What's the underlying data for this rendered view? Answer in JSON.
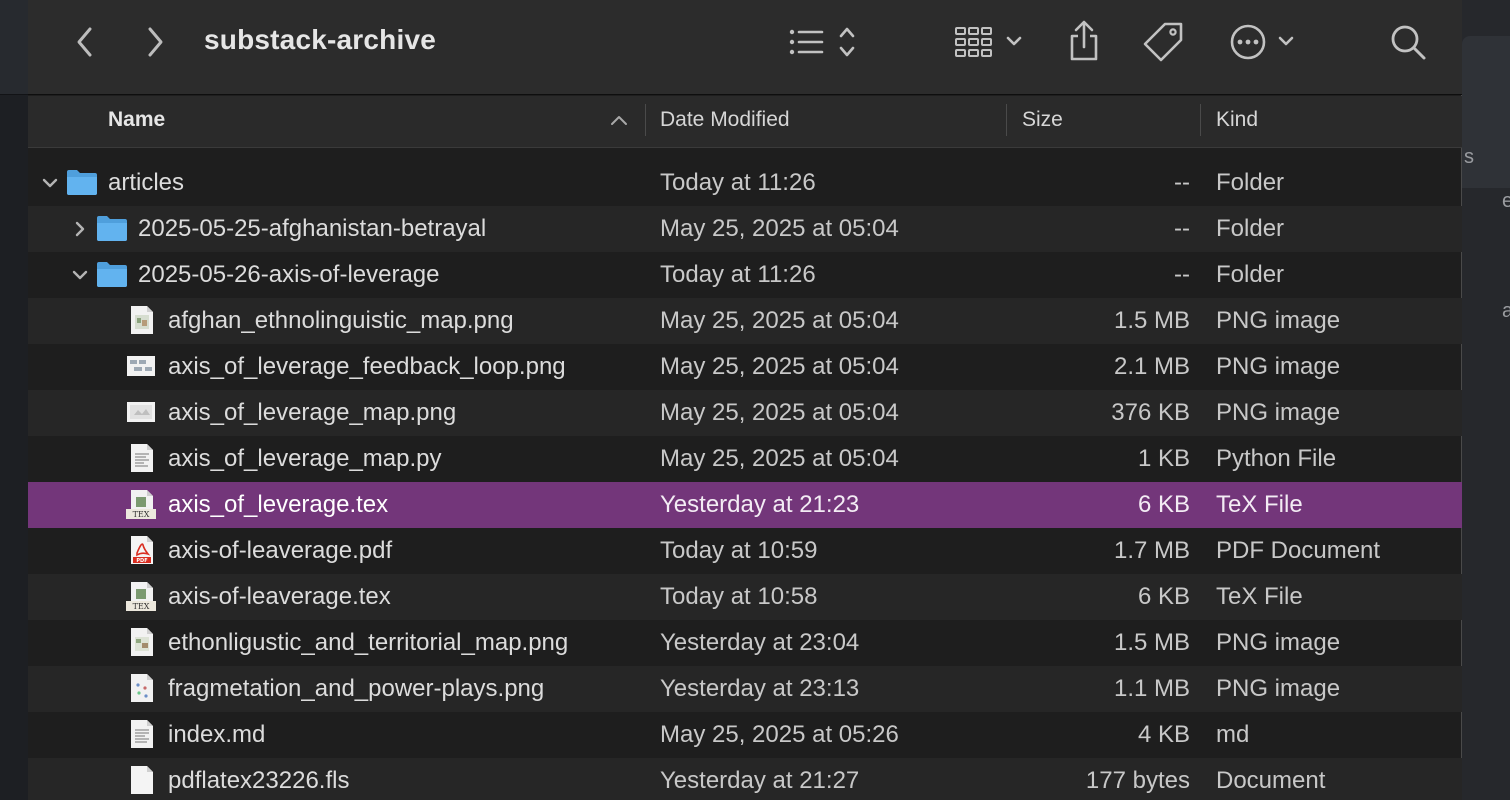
{
  "window": {
    "title": "substack-archive"
  },
  "toolbar": {
    "back_icon": "chevron-left-icon",
    "forward_icon": "chevron-right-icon",
    "list_view_icon": "list-view-icon",
    "group_icon": "grid-group-icon",
    "share_icon": "share-icon",
    "tag_icon": "tag-icon",
    "more_icon": "ellipsis-circle-icon",
    "search_icon": "search-icon"
  },
  "columns": {
    "name": "Name",
    "date": "Date Modified",
    "size": "Size",
    "kind": "Kind"
  },
  "rows": [
    {
      "name": "articles",
      "date": "Today at 11:26",
      "size": "--",
      "kind": "Folder"
    },
    {
      "name": "2025-05-25-afghanistan-betrayal",
      "date": "May 25, 2025 at 05:04",
      "size": "--",
      "kind": "Folder"
    },
    {
      "name": "2025-05-26-axis-of-leverage",
      "date": "Today at 11:26",
      "size": "--",
      "kind": "Folder"
    },
    {
      "name": "afghan_ethnolinguistic_map.png",
      "date": "May 25, 2025 at 05:04",
      "size": "1.5 MB",
      "kind": "PNG image"
    },
    {
      "name": "axis_of_leverage_feedback_loop.png",
      "date": "May 25, 2025 at 05:04",
      "size": "2.1 MB",
      "kind": "PNG image"
    },
    {
      "name": "axis_of_leverage_map.png",
      "date": "May 25, 2025 at 05:04",
      "size": "376 KB",
      "kind": "PNG image"
    },
    {
      "name": "axis_of_leverage_map.py",
      "date": "May 25, 2025 at 05:04",
      "size": "1 KB",
      "kind": "Python File"
    },
    {
      "name": "axis_of_leverage.tex",
      "date": "Yesterday at 21:23",
      "size": "6 KB",
      "kind": "TeX File"
    },
    {
      "name": "axis-of-leaverage.pdf",
      "date": "Today at 10:59",
      "size": "1.7 MB",
      "kind": "PDF Document"
    },
    {
      "name": "axis-of-leaverage.tex",
      "date": "Today at 10:58",
      "size": "6 KB",
      "kind": "TeX File"
    },
    {
      "name": "ethonligustic_and_territorial_map.png",
      "date": "Yesterday at 23:04",
      "size": "1.5 MB",
      "kind": "PNG image"
    },
    {
      "name": "fragmetation_and_power-plays.png",
      "date": "Yesterday at 23:13",
      "size": "1.1 MB",
      "kind": "PNG image"
    },
    {
      "name": "index.md",
      "date": "May 25, 2025 at 05:26",
      "size": "4 KB",
      "kind": "md"
    },
    {
      "name": "pdflatex23226.fls",
      "date": "Yesterday at 21:27",
      "size": "177 bytes",
      "kind": "Document"
    }
  ],
  "selection": {
    "selected_name": "axis_of_leverage.tex"
  },
  "colors": {
    "selection": "#73367a",
    "folder": "#5aa9e6",
    "pdf": "#d92d20"
  }
}
